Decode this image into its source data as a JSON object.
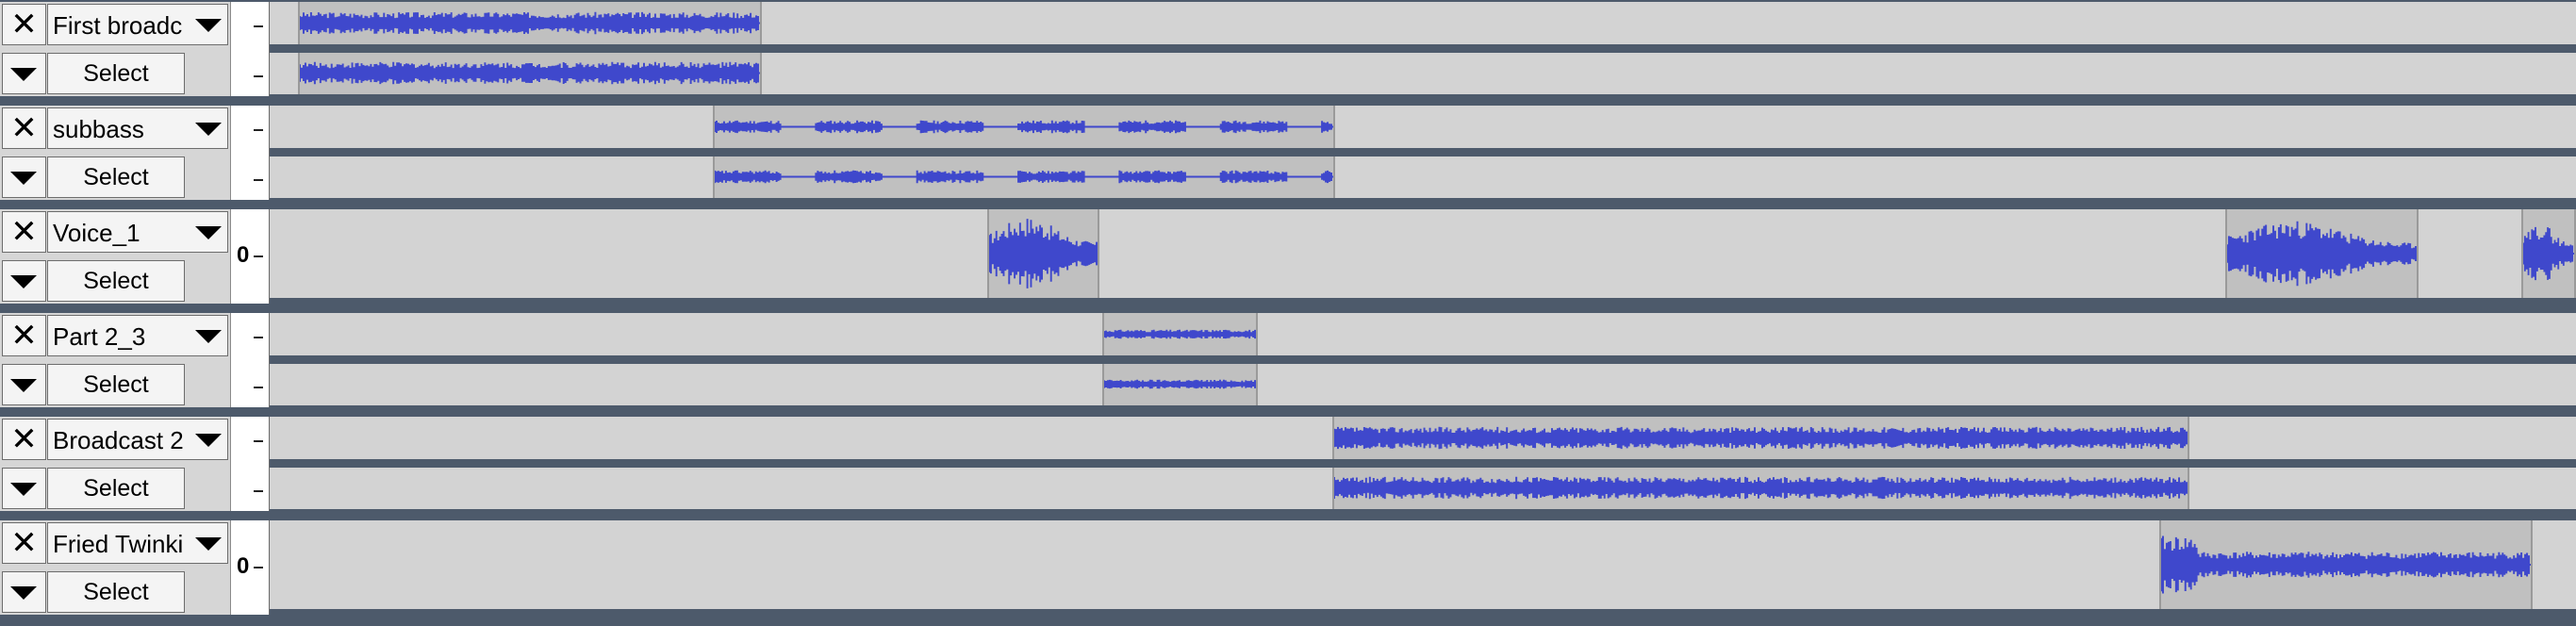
{
  "controls": {
    "close_symbol": "✕",
    "select_label": "Select",
    "zero_label": "0"
  },
  "timeline": {
    "visible_seconds": 2446,
    "start_second": 0
  },
  "colors": {
    "waveform": "#3f48cc",
    "clip_background": "#c0c0c0",
    "track_background": "#d3d3d3",
    "separator": "#4d5a6b"
  },
  "tracks": [
    {
      "name": "First broadc",
      "channels": 2,
      "clips": [
        {
          "start": 30,
          "end": 522,
          "amplitude": 0.6,
          "seed": 3
        }
      ]
    },
    {
      "name": "subbass",
      "channels": 2,
      "clips": [
        {
          "start": 470,
          "end": 1130,
          "amplitude": 0.35,
          "seed": 11,
          "style": "dashes"
        }
      ]
    },
    {
      "name": "Voice_1",
      "channels": 1,
      "clips": [
        {
          "start": 761,
          "end": 880,
          "amplitude": 0.9,
          "seed": 17,
          "style": "burst"
        },
        {
          "start": 2074,
          "end": 2279,
          "amplitude": 0.8,
          "seed": 23,
          "style": "burst"
        },
        {
          "start": 2388,
          "end": 2446,
          "amplitude": 0.75,
          "seed": 29,
          "style": "burst"
        }
      ]
    },
    {
      "name": "Part 2_3",
      "channels": 2,
      "clips": [
        {
          "start": 883,
          "end": 1048,
          "amplitude": 0.25,
          "seed": 31
        }
      ]
    },
    {
      "name": "Broadcast 2",
      "channels": 2,
      "clips": [
        {
          "start": 1127,
          "end": 2036,
          "amplitude": 0.6,
          "seed": 37
        }
      ]
    },
    {
      "name": "Fried Twinki",
      "channels": 1,
      "clips": [
        {
          "start": 2004,
          "end": 2400,
          "amplitude": 0.7,
          "seed": 41,
          "style": "decay"
        }
      ]
    }
  ]
}
